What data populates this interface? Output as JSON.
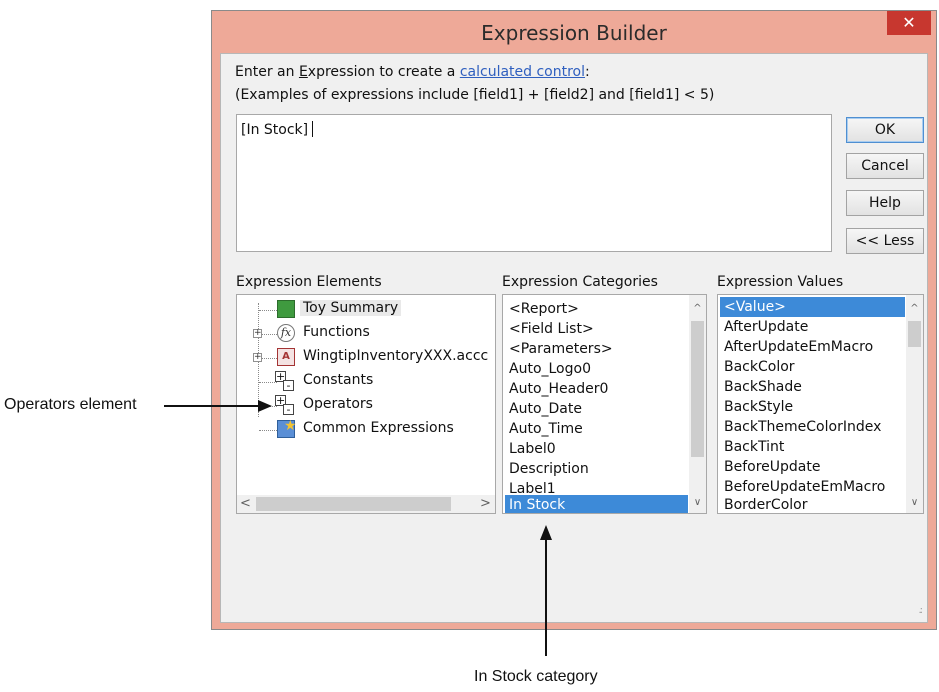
{
  "window": {
    "title": "Expression Builder",
    "close_glyph": "✕"
  },
  "instructions": {
    "line1_prefix": "Enter an ",
    "line1_underline_letter": "E",
    "line1_mid": "xpression to create a ",
    "line1_link": "calculated control",
    "line1_suffix": ":",
    "line2": "(Examples of expressions include [field1] + [field2] and [field1] < 5)"
  },
  "expression": {
    "value": "[In Stock]"
  },
  "buttons": {
    "ok": "OK",
    "cancel": "Cancel",
    "help": "Help",
    "less": "<< Less"
  },
  "panels": {
    "elements": {
      "label": "Expression Elements",
      "items": [
        {
          "label": "Toy Summary",
          "icon": "report-icon",
          "selected": true
        },
        {
          "label": "Functions",
          "icon": "function-icon",
          "expander": "+"
        },
        {
          "label": "WingtipInventoryXXX.accc",
          "icon": "database-icon",
          "expander": "+"
        },
        {
          "label": "Constants",
          "icon": "constants-icon"
        },
        {
          "label": "Operators",
          "icon": "operators-icon"
        },
        {
          "label": "Common Expressions",
          "icon": "common-expressions-icon"
        }
      ]
    },
    "categories": {
      "label": "Expression Categories",
      "items": [
        "<Report>",
        "<Field List>",
        "<Parameters>",
        "Auto_Logo0",
        "Auto_Header0",
        "Auto_Date",
        "Auto_Time",
        "Label0",
        "Description",
        "Label1",
        "In Stock"
      ],
      "selected": "In Stock"
    },
    "values": {
      "label": "Expression Values",
      "items": [
        "<Value>",
        "AfterUpdate",
        "AfterUpdateEmMacro",
        "BackColor",
        "BackShade",
        "BackStyle",
        "BackThemeColorIndex",
        "BackTint",
        "BeforeUpdate",
        "BeforeUpdateEmMacro",
        "BorderColor"
      ],
      "selected": "<Value>"
    }
  },
  "annotations": {
    "operators": "Operators element",
    "in_stock": "In Stock category"
  },
  "colors": {
    "window_frame": "#eea998",
    "close_button": "#c7372f",
    "selection": "#3d8ad8",
    "link": "#2f5fbf"
  }
}
